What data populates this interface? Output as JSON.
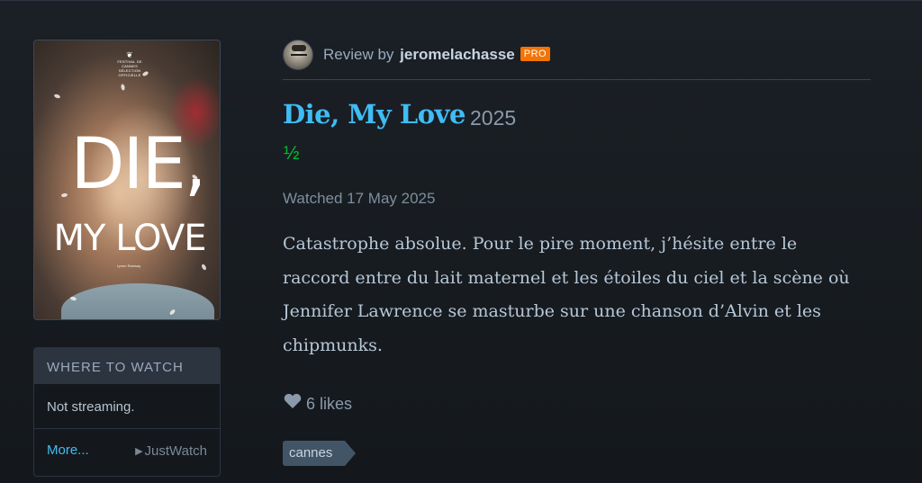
{
  "poster": {
    "festival": "FESTIVAL DE CANNES",
    "festival_sub": "SÉLECTION OFFICIELLE",
    "title_line1": "DIE,",
    "title_line2": "MY LOVE",
    "credit": "Lynne Ramsay"
  },
  "where_to_watch": {
    "header": "WHERE TO WATCH",
    "status": "Not streaming.",
    "more_label": "More...",
    "provider": "JustWatch"
  },
  "review": {
    "by_label": "Review by",
    "username": "jeromelachasse",
    "badge": "PRO",
    "film_title": "Die, My Love",
    "film_year": "2025",
    "rating": "½",
    "watched": "Watched 17 May 2025",
    "text": "Catastrophe absolue. Pour le pire moment, j’hésite entre le raccord entre du lait maternel et les étoiles du ciel et la scène où Jennifer Lawrence se masturbe sur une chanson d’Alvin et les chipmunks.",
    "likes": "6 likes",
    "tag": "cannes"
  },
  "colors": {
    "background": "#14181c",
    "link": "#40bcf4",
    "rating": "#00c030",
    "pro_badge": "#f27405",
    "tag_bg": "#425566"
  }
}
